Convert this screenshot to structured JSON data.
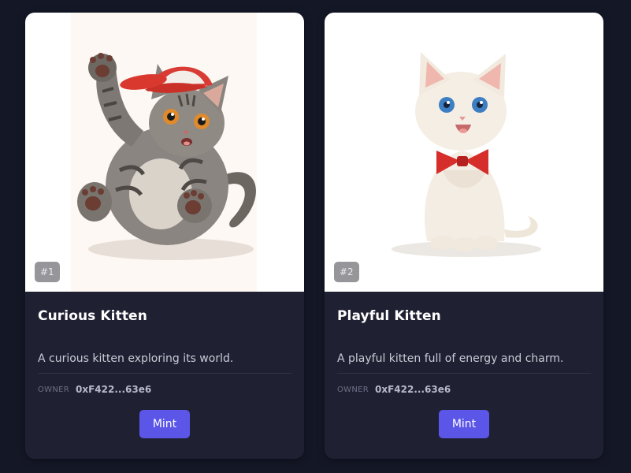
{
  "cards": [
    {
      "badge": "#1",
      "title": "Curious Kitten",
      "description": "A curious kitten exploring its world.",
      "owner_label": "OWNER",
      "owner": "0xF422...63e6",
      "action_label": "Mint"
    },
    {
      "badge": "#2",
      "title": "Playful Kitten",
      "description": "A playful kitten full of energy and charm.",
      "owner_label": "OWNER",
      "owner": "0xF422...63e6",
      "action_label": "Mint"
    }
  ],
  "colors": {
    "page_background": "#141726",
    "card_background": "#1f2133",
    "accent": "#5b55e8"
  }
}
